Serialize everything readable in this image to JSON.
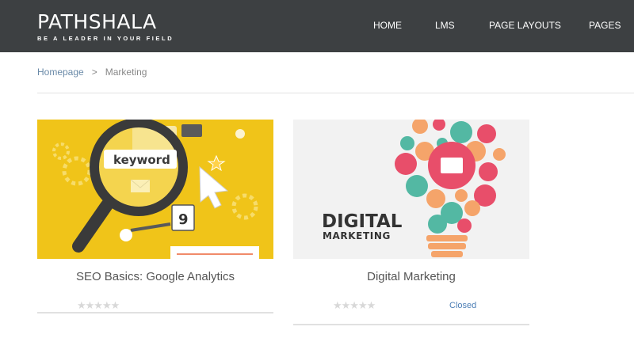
{
  "header": {
    "logo_title": "PATHSHALA",
    "logo_tagline": "BE A LEADER IN YOUR FIELD",
    "nav": [
      "HOME",
      "LMS",
      "PAGE LAYOUTS",
      "PAGES"
    ]
  },
  "breadcrumb": {
    "home": "Homepage",
    "separator": ">",
    "current": "Marketing"
  },
  "courses": [
    {
      "title": "SEO Basics: Google Analytics",
      "image_text": "keyword",
      "image_badge": "9",
      "rating_stars": 0,
      "stars": "★★★★★",
      "status": ""
    },
    {
      "title": "Digital Marketing",
      "image_text_line1": "DIGITAL",
      "image_text_line2": "MARKETING",
      "rating_stars": 0,
      "stars": "★★★★★",
      "status": "Closed"
    }
  ],
  "colors": {
    "header_bg": "#3d4042",
    "seo_bg": "#f0c419",
    "link": "#6a8aa8",
    "status": "#4d7fb6"
  }
}
